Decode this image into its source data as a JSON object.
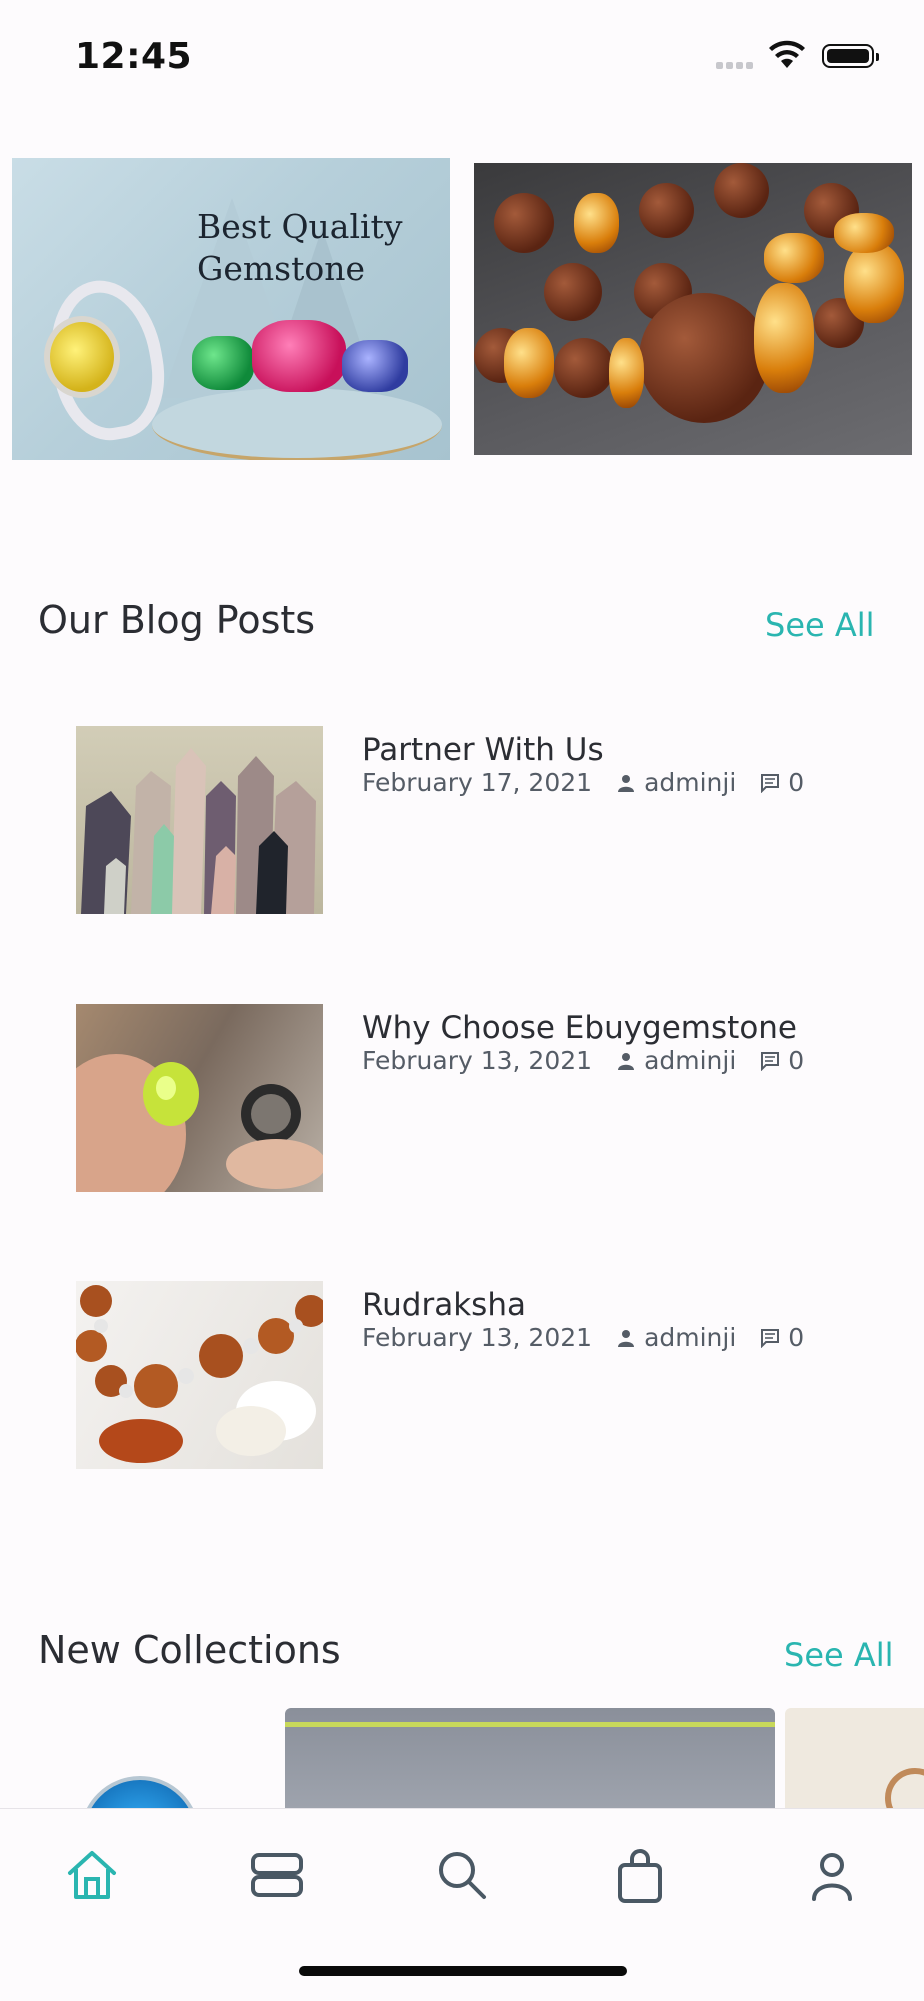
{
  "status_bar": {
    "time": "12:45"
  },
  "banners": [
    {
      "title_line1": "Best Quality",
      "title_line2": "Gemstone"
    },
    {
      "title_line1": "",
      "title_line2": ""
    }
  ],
  "blog": {
    "title": "Our Blog Posts",
    "see_all": "See All",
    "posts": [
      {
        "title": "Partner With Us",
        "date": "February 17, 2021",
        "author": "adminji",
        "comments": "0"
      },
      {
        "title": "Why Choose Ebuygemstone",
        "date": "February 13, 2021",
        "author": "adminji",
        "comments": "0"
      },
      {
        "title": "Rudraksha",
        "date": "February 13, 2021",
        "author": "adminji",
        "comments": "0"
      }
    ]
  },
  "collections": {
    "title": "New Collections",
    "see_all": "See All"
  },
  "tab_bar": {
    "items": [
      {
        "icon": "home-icon",
        "active": true
      },
      {
        "icon": "categories-icon",
        "active": false
      },
      {
        "icon": "search-icon",
        "active": false
      },
      {
        "icon": "bag-icon",
        "active": false
      },
      {
        "icon": "profile-icon",
        "active": false
      }
    ],
    "active_color": "#2ab5b0",
    "inactive_color": "#4a5864"
  }
}
